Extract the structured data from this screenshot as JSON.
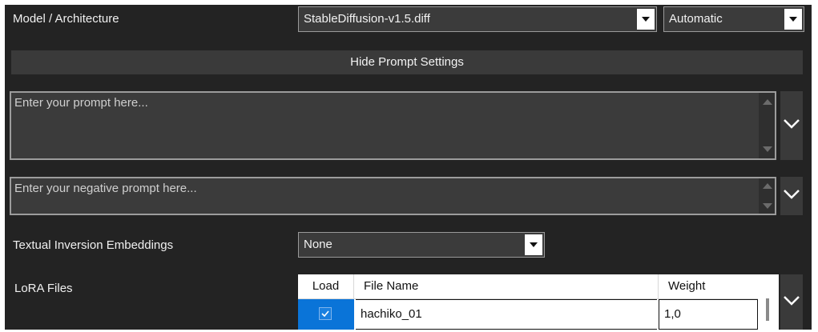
{
  "model": {
    "label": "Model / Architecture",
    "file_value": "StableDiffusion-v1.5.diff",
    "arch_value": "Automatic"
  },
  "prompt_toggle_label": "Hide Prompt Settings",
  "prompt": {
    "placeholder": "Enter your prompt here..."
  },
  "negative_prompt": {
    "placeholder": "Enter your negative prompt here..."
  },
  "embeddings": {
    "label": "Textual Inversion Embeddings",
    "value": "None"
  },
  "lora": {
    "label": "LoRA Files",
    "columns": [
      "Load",
      "File Name",
      "Weight"
    ],
    "rows": [
      {
        "load": true,
        "file_name": "hachiko_01",
        "weight": "1,0"
      }
    ]
  },
  "icons": {
    "dropdown": "chevron-down-icon",
    "expand": "chevron-down-icon",
    "check": "check-icon"
  },
  "colors": {
    "panel_bg": "#232323",
    "selected_row": "#0a74d8"
  }
}
